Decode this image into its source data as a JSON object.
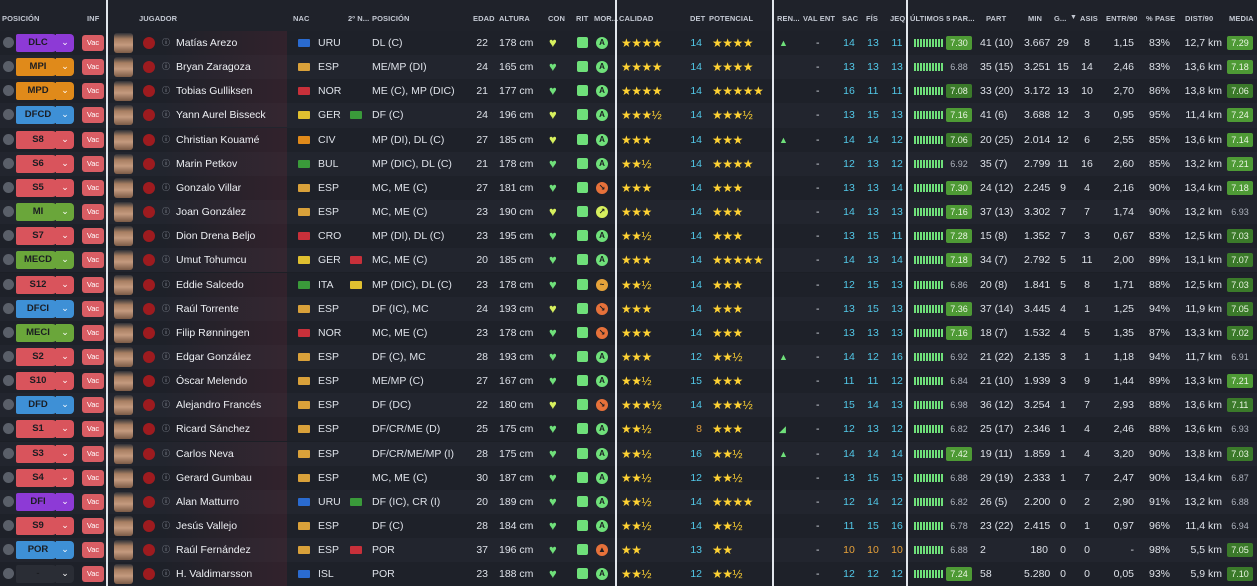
{
  "headers": {
    "posicion": "POSICIÓN",
    "inf": "INF",
    "jugador": "JUGADOR",
    "nac": "NAC",
    "nac2": "2º N...",
    "posicion2": "POSICIÓN",
    "edad": "EDAD",
    "altura": "ALTURA",
    "con": "CON",
    "rit": "RIT",
    "mor": "MOR...",
    "calidad": "CALIDAD",
    "det": "DET",
    "potencial": "POTENCIAL",
    "ren": "REN...",
    "valent": "VAL ENT",
    "sac": "SAC",
    "fis": "FÍS",
    "jeq": "JEQ",
    "ultimos": "ÚLTIMOS 5 PAR...",
    "part": "PART",
    "min": "MIN",
    "g": "G...",
    "sort_icon": "▼",
    "asis": "ASIS",
    "entr": "ENTR/90",
    "pase": "% PASE",
    "dist": "DIST/90",
    "media": "MEDIA"
  },
  "colors": {
    "purple": "#8d3ad6",
    "orange": "#e08a1a",
    "blue": "#3e90d6",
    "red": "#d9545c",
    "green": "#6aa63a",
    "navy": "#2a6bd0"
  },
  "players": [
    {
      "pos": "DLC",
      "posc": "#8d3ad6",
      "arrow": "⌄",
      "inf": "Vac",
      "name": "Matías Arezo",
      "flag": "#2a6bd0",
      "nat": "URU",
      "flag2": "",
      "posi": "DL (C)",
      "age": "22",
      "alt": "178 cm",
      "heart": "♥",
      "heartc": "#d7f05e",
      "morc": "#6fe07a",
      "mor": "A",
      "stars": "★★★★",
      "det": "14",
      "pot": "★★★★",
      "ren": "▲",
      "valent": "-",
      "sac": "14",
      "fis": "13",
      "jeq": "11",
      "sb": "7.30",
      "sbc": "hib",
      "part": "41 (10)",
      "min": "3.667",
      "g": "29",
      "asis": "8",
      "entr": "1,15",
      "pase": "83%",
      "dist": "12,7 km",
      "media": "7.29",
      "mc": "hib"
    },
    {
      "pos": "MPI",
      "posc": "#e08a1a",
      "arrow": "⌄",
      "inf": "Vac",
      "name": "Bryan Zaragoza",
      "flag": "#d9a13a",
      "nat": "ESP",
      "flag2": "",
      "posi": "ME/MP (DI)",
      "age": "24",
      "alt": "165 cm",
      "heart": "♥",
      "heartc": "#6fe07a",
      "morc": "#6fe07a",
      "mor": "A",
      "stars": "★★★★",
      "det": "14",
      "pot": "★★★★",
      "ren": "",
      "valent": "-",
      "sac": "13",
      "fis": "13",
      "jeq": "13",
      "sb": "6.88",
      "sbc": "lowb",
      "part": "35 (15)",
      "min": "3.251",
      "g": "15",
      "asis": "14",
      "entr": "2,46",
      "pase": "83%",
      "dist": "13,6 km",
      "media": "7.18",
      "mc": "hib"
    },
    {
      "pos": "MPD",
      "posc": "#e08a1a",
      "arrow": "⌄",
      "inf": "Vac",
      "name": "Tobias Gulliksen",
      "flag": "#c8303a",
      "nat": "NOR",
      "flag2": "",
      "posi": "ME (C), MP (DIC)",
      "age": "21",
      "alt": "177 cm",
      "heart": "♥",
      "heartc": "#6fe07a",
      "morc": "#6fe07a",
      "mor": "A",
      "stars": "★★★★",
      "det": "14",
      "pot": "★★★★★",
      "ren": "",
      "valent": "-",
      "sac": "16",
      "fis": "11",
      "jeq": "11",
      "sb": "7.08",
      "sbc": "midb",
      "part": "33 (20)",
      "min": "3.172",
      "g": "13",
      "asis": "10",
      "entr": "2,70",
      "pase": "86%",
      "dist": "13,8 km",
      "media": "7.06",
      "mc": "midb"
    },
    {
      "pos": "DFCD",
      "posc": "#3e90d6",
      "arrow": "⌄",
      "inf": "Vac",
      "name": "Yann Aurel Bisseck",
      "flag": "#e0c030",
      "nat": "GER",
      "flag2": "#3a9a3a",
      "posi": "DF (C)",
      "age": "24",
      "alt": "196 cm",
      "heart": "♥",
      "heartc": "#d7f05e",
      "morc": "#6fe07a",
      "mor": "A",
      "stars": "★★★½",
      "det": "14",
      "pot": "★★★½",
      "ren": "",
      "valent": "-",
      "sac": "13",
      "fis": "15",
      "jeq": "13",
      "sb": "7.16",
      "sbc": "hib",
      "part": "41 (6)",
      "min": "3.688",
      "g": "12",
      "asis": "3",
      "entr": "0,95",
      "pase": "95%",
      "dist": "11,4 km",
      "media": "7.24",
      "mc": "hib"
    },
    {
      "pos": "S8",
      "posc": "#d9545c",
      "arrow": "⌄",
      "inf": "Vac",
      "name": "Christian Kouamé",
      "flag": "#e08a1a",
      "nat": "CIV",
      "flag2": "",
      "posi": "MP (DI), DL (C)",
      "age": "27",
      "alt": "185 cm",
      "heart": "♥",
      "heartc": "#d7f05e",
      "morc": "#6fe07a",
      "mor": "A",
      "stars": "★★★",
      "det": "14",
      "pot": "★★★",
      "ren": "▲",
      "valent": "-",
      "sac": "14",
      "fis": "14",
      "jeq": "12",
      "sb": "7.06",
      "sbc": "midb",
      "part": "20 (25)",
      "min": "2.014",
      "g": "12",
      "asis": "6",
      "entr": "2,55",
      "pase": "85%",
      "dist": "13,6 km",
      "media": "7.14",
      "mc": "hib"
    },
    {
      "pos": "S6",
      "posc": "#d9545c",
      "arrow": "⌄",
      "inf": "Vac",
      "name": "Marin Petkov",
      "flag": "#3a9a3a",
      "nat": "BUL",
      "flag2": "",
      "posi": "MP (DIC), DL (C)",
      "age": "21",
      "alt": "178 cm",
      "heart": "♥",
      "heartc": "#6fe07a",
      "morc": "#6fe07a",
      "mor": "A",
      "stars": "★★½",
      "det": "14",
      "pot": "★★★★",
      "ren": "",
      "valent": "-",
      "sac": "12",
      "fis": "13",
      "jeq": "12",
      "sb": "6.92",
      "sbc": "lowb",
      "part": "35 (7)",
      "min": "2.799",
      "g": "11",
      "asis": "16",
      "entr": "2,60",
      "pase": "85%",
      "dist": "13,2 km",
      "media": "7.21",
      "mc": "hib"
    },
    {
      "pos": "S5",
      "posc": "#d9545c",
      "arrow": "⌄",
      "inf": "Vac",
      "name": "Gonzalo Villar",
      "flag": "#d9a13a",
      "nat": "ESP",
      "flag2": "",
      "posi": "MC, ME (C)",
      "age": "27",
      "alt": "181 cm",
      "heart": "♥",
      "heartc": "#6fe07a",
      "morc": "#e6713a",
      "mor": "↘",
      "stars": "★★★",
      "det": "14",
      "pot": "★★★",
      "ren": "",
      "valent": "-",
      "sac": "13",
      "fis": "13",
      "jeq": "14",
      "sb": "7.30",
      "sbc": "hib",
      "part": "24 (12)",
      "min": "2.245",
      "g": "9",
      "asis": "4",
      "entr": "2,16",
      "pase": "90%",
      "dist": "13,4 km",
      "media": "7.18",
      "mc": "hib"
    },
    {
      "pos": "MI",
      "posc": "#6aa63a",
      "arrow": "⌄",
      "inf": "Vac",
      "name": "Joan González",
      "flag": "#d9a13a",
      "nat": "ESP",
      "flag2": "",
      "posi": "MC, ME (C)",
      "age": "23",
      "alt": "190 cm",
      "heart": "♥",
      "heartc": "#d7f05e",
      "morc": "#d7f05e",
      "mor": "↗",
      "stars": "★★★",
      "det": "14",
      "pot": "★★★",
      "ren": "",
      "valent": "-",
      "sac": "14",
      "fis": "13",
      "jeq": "13",
      "sb": "7.16",
      "sbc": "hib",
      "part": "37 (13)",
      "min": "3.302",
      "g": "7",
      "asis": "7",
      "entr": "1,74",
      "pase": "90%",
      "dist": "13,2 km",
      "media": "6.93",
      "mc": "lowb"
    },
    {
      "pos": "S7",
      "posc": "#d9545c",
      "arrow": "⌄",
      "inf": "Vac",
      "name": "Dion Drena Beljo",
      "flag": "#c8303a",
      "nat": "CRO",
      "flag2": "",
      "posi": "MP (DI), DL (C)",
      "age": "23",
      "alt": "195 cm",
      "heart": "♥",
      "heartc": "#6fe07a",
      "morc": "#6fe07a",
      "mor": "A",
      "stars": "★★½",
      "det": "14",
      "pot": "★★★",
      "ren": "",
      "valent": "-",
      "sac": "13",
      "fis": "15",
      "jeq": "11",
      "sb": "7.28",
      "sbc": "hib",
      "part": "15 (8)",
      "min": "1.352",
      "g": "7",
      "asis": "3",
      "entr": "0,67",
      "pase": "83%",
      "dist": "12,5 km",
      "media": "7.03",
      "mc": "midb"
    },
    {
      "pos": "MECD",
      "posc": "#6aa63a",
      "arrow": "⌄",
      "inf": "Vac",
      "name": "Umut Tohumcu",
      "flag": "#e0c030",
      "nat": "GER",
      "flag2": "#c8303a",
      "posi": "MC, ME (C)",
      "age": "20",
      "alt": "185 cm",
      "heart": "♥",
      "heartc": "#6fe07a",
      "morc": "#6fe07a",
      "mor": "A",
      "stars": "★★★",
      "det": "14",
      "pot": "★★★★★",
      "ren": "",
      "valent": "-",
      "sac": "14",
      "fis": "13",
      "jeq": "14",
      "sb": "7.18",
      "sbc": "hib",
      "part": "34 (7)",
      "min": "2.792",
      "g": "5",
      "asis": "11",
      "entr": "2,00",
      "pase": "89%",
      "dist": "13,1 km",
      "media": "7.07",
      "mc": "midb"
    },
    {
      "pos": "S12",
      "posc": "#d9545c",
      "arrow": "⌄",
      "inf": "Vac",
      "name": "Eddie Salcedo",
      "flag": "#3a9a3a",
      "nat": "ITA",
      "flag2": "#e0c030",
      "posi": "MP (DIC), DL (C)",
      "age": "23",
      "alt": "178 cm",
      "heart": "♥",
      "heartc": "#6fe07a",
      "morc": "#e6a33a",
      "mor": "~",
      "stars": "★★½",
      "det": "14",
      "pot": "★★★",
      "ren": "",
      "valent": "-",
      "sac": "12",
      "fis": "15",
      "jeq": "13",
      "sb": "6.86",
      "sbc": "lowb",
      "part": "20 (8)",
      "min": "1.841",
      "g": "5",
      "asis": "8",
      "entr": "1,71",
      "pase": "88%",
      "dist": "12,5 km",
      "media": "7.03",
      "mc": "midb"
    },
    {
      "pos": "DFCI",
      "posc": "#3e90d6",
      "arrow": "⌄",
      "inf": "Vac",
      "name": "Raúl Torrente",
      "flag": "#d9a13a",
      "nat": "ESP",
      "flag2": "",
      "posi": "DF (IC), MC",
      "age": "24",
      "alt": "193 cm",
      "heart": "♥",
      "heartc": "#d7f05e",
      "morc": "#e6713a",
      "mor": "↘",
      "stars": "★★★",
      "det": "14",
      "pot": "★★★",
      "ren": "",
      "valent": "-",
      "sac": "13",
      "fis": "15",
      "jeq": "13",
      "sb": "7.36",
      "sbc": "hib",
      "part": "37 (14)",
      "min": "3.445",
      "g": "4",
      "asis": "1",
      "entr": "1,25",
      "pase": "94%",
      "dist": "11,9 km",
      "media": "7.05",
      "mc": "midb"
    },
    {
      "pos": "MECI",
      "posc": "#6aa63a",
      "arrow": "⌄",
      "inf": "Vac",
      "name": "Filip Rønningen",
      "flag": "#c8303a",
      "nat": "NOR",
      "flag2": "",
      "posi": "MC, ME (C)",
      "age": "23",
      "alt": "178 cm",
      "heart": "♥",
      "heartc": "#6fe07a",
      "morc": "#e6713a",
      "mor": "↘",
      "stars": "★★★",
      "det": "14",
      "pot": "★★★",
      "ren": "",
      "valent": "-",
      "sac": "13",
      "fis": "13",
      "jeq": "13",
      "sb": "7.16",
      "sbc": "hib",
      "part": "18 (7)",
      "min": "1.532",
      "g": "4",
      "asis": "5",
      "entr": "1,35",
      "pase": "87%",
      "dist": "13,3 km",
      "media": "7.02",
      "mc": "midb"
    },
    {
      "pos": "S2",
      "posc": "#d9545c",
      "arrow": "⌄",
      "inf": "Vac",
      "name": "Edgar González",
      "flag": "#d9a13a",
      "nat": "ESP",
      "flag2": "",
      "posi": "DF (C), MC",
      "age": "28",
      "alt": "193 cm",
      "heart": "♥",
      "heartc": "#6fe07a",
      "morc": "#6fe07a",
      "mor": "A",
      "stars": "★★★",
      "det": "12",
      "pot": "★★½",
      "ren": "▲",
      "valent": "-",
      "sac": "14",
      "fis": "12",
      "jeq": "16",
      "sb": "6.92",
      "sbc": "lowb",
      "part": "21 (22)",
      "min": "2.135",
      "g": "3",
      "asis": "1",
      "entr": "1,18",
      "pase": "94%",
      "dist": "11,7 km",
      "media": "6.91",
      "mc": "lowb"
    },
    {
      "pos": "S10",
      "posc": "#d9545c",
      "arrow": "⌄",
      "inf": "Vac",
      "name": "Óscar Melendo",
      "flag": "#d9a13a",
      "nat": "ESP",
      "flag2": "",
      "posi": "ME/MP (C)",
      "age": "27",
      "alt": "167 cm",
      "heart": "♥",
      "heartc": "#6fe07a",
      "morc": "#6fe07a",
      "mor": "A",
      "stars": "★★½",
      "det": "15",
      "pot": "★★★",
      "ren": "",
      "valent": "-",
      "sac": "11",
      "fis": "11",
      "jeq": "12",
      "sb": "6.84",
      "sbc": "lowb",
      "part": "21 (10)",
      "min": "1.939",
      "g": "3",
      "asis": "9",
      "entr": "1,44",
      "pase": "89%",
      "dist": "13,3 km",
      "media": "7.21",
      "mc": "hib"
    },
    {
      "pos": "DFD",
      "posc": "#3e90d6",
      "arrow": "⌄",
      "inf": "Vac",
      "name": "Alejandro Francés",
      "flag": "#d9a13a",
      "nat": "ESP",
      "flag2": "",
      "posi": "DF (DC)",
      "age": "22",
      "alt": "180 cm",
      "heart": "♥",
      "heartc": "#d7f05e",
      "morc": "#e6713a",
      "mor": "↘",
      "stars": "★★★½",
      "det": "14",
      "pot": "★★★½",
      "ren": "",
      "valent": "-",
      "sac": "15",
      "fis": "14",
      "jeq": "13",
      "sb": "6.98",
      "sbc": "lowb",
      "part": "36 (12)",
      "min": "3.254",
      "g": "1",
      "asis": "7",
      "entr": "2,93",
      "pase": "88%",
      "dist": "13,6 km",
      "media": "7.11",
      "mc": "midb"
    },
    {
      "pos": "S1",
      "posc": "#d9545c",
      "arrow": "⌄",
      "inf": "Vac",
      "name": "Ricard Sánchez",
      "flag": "#d9a13a",
      "nat": "ESP",
      "flag2": "",
      "posi": "DF/CR/ME (D)",
      "age": "25",
      "alt": "175 cm",
      "heart": "♥",
      "heartc": "#6fe07a",
      "morc": "#6fe07a",
      "mor": "A",
      "stars": "★★½",
      "det": "8",
      "pot": "★★★",
      "ren": "◢",
      "valent": "-",
      "sac": "12",
      "fis": "13",
      "jeq": "12",
      "sb": "6.82",
      "sbc": "lowb",
      "part": "25 (17)",
      "min": "2.346",
      "g": "1",
      "asis": "4",
      "entr": "2,46",
      "pase": "88%",
      "dist": "13,6 km",
      "media": "6.93",
      "mc": "lowb"
    },
    {
      "pos": "S3",
      "posc": "#d9545c",
      "arrow": "⌄",
      "inf": "Vac",
      "name": "Carlos Neva",
      "flag": "#d9a13a",
      "nat": "ESP",
      "flag2": "",
      "posi": "DF/CR/ME/MP (I)",
      "age": "28",
      "alt": "175 cm",
      "heart": "♥",
      "heartc": "#6fe07a",
      "morc": "#6fe07a",
      "mor": "A",
      "stars": "★★½",
      "det": "16",
      "pot": "★★½",
      "ren": "▲",
      "valent": "-",
      "sac": "14",
      "fis": "14",
      "jeq": "14",
      "sb": "7.42",
      "sbc": "hib",
      "part": "19 (11)",
      "min": "1.859",
      "g": "1",
      "asis": "4",
      "entr": "3,20",
      "pase": "90%",
      "dist": "13,8 km",
      "media": "7.03",
      "mc": "midb"
    },
    {
      "pos": "S4",
      "posc": "#d9545c",
      "arrow": "⌄",
      "inf": "Vac",
      "name": "Gerard Gumbau",
      "flag": "#d9a13a",
      "nat": "ESP",
      "flag2": "",
      "posi": "MC, ME (C)",
      "age": "30",
      "alt": "187 cm",
      "heart": "♥",
      "heartc": "#6fe07a",
      "morc": "#6fe07a",
      "mor": "A",
      "stars": "★★½",
      "det": "12",
      "pot": "★★½",
      "ren": "",
      "valent": "-",
      "sac": "13",
      "fis": "15",
      "jeq": "15",
      "sb": "6.88",
      "sbc": "lowb",
      "part": "29 (19)",
      "min": "2.333",
      "g": "1",
      "asis": "7",
      "entr": "2,47",
      "pase": "90%",
      "dist": "13,4 km",
      "media": "6.87",
      "mc": "lowb"
    },
    {
      "pos": "DFI",
      "posc": "#8d3ad6",
      "arrow": "⌄",
      "inf": "Vac",
      "name": "Alan Matturro",
      "flag": "#2a6bd0",
      "nat": "URU",
      "flag2": "#3a9a3a",
      "posi": "DF (IC), CR (I)",
      "age": "20",
      "alt": "189 cm",
      "heart": "♥",
      "heartc": "#6fe07a",
      "morc": "#6fe07a",
      "mor": "A",
      "stars": "★★½",
      "det": "14",
      "pot": "★★★★",
      "ren": "",
      "valent": "-",
      "sac": "12",
      "fis": "14",
      "jeq": "12",
      "sb": "6.82",
      "sbc": "lowb",
      "part": "26 (5)",
      "min": "2.200",
      "g": "0",
      "asis": "2",
      "entr": "2,90",
      "pase": "91%",
      "dist": "13,2 km",
      "media": "6.88",
      "mc": "lowb"
    },
    {
      "pos": "S9",
      "posc": "#d9545c",
      "arrow": "⌄",
      "inf": "Vac",
      "name": "Jesús Vallejo",
      "flag": "#d9a13a",
      "nat": "ESP",
      "flag2": "",
      "posi": "DF (C)",
      "age": "28",
      "alt": "184 cm",
      "heart": "♥",
      "heartc": "#6fe07a",
      "morc": "#6fe07a",
      "mor": "A",
      "stars": "★★½",
      "det": "14",
      "pot": "★★½",
      "ren": "",
      "valent": "-",
      "sac": "11",
      "fis": "15",
      "jeq": "16",
      "sb": "6.78",
      "sbc": "lowb",
      "part": "23 (22)",
      "min": "2.415",
      "g": "0",
      "asis": "1",
      "entr": "0,97",
      "pase": "96%",
      "dist": "11,4 km",
      "media": "6.94",
      "mc": "lowb"
    },
    {
      "pos": "POR",
      "posc": "#3e90d6",
      "arrow": "⌄",
      "inf": "Vac",
      "name": "Raúl Fernández",
      "flag": "#d9a13a",
      "nat": "ESP",
      "flag2": "#c8303a",
      "posi": "POR",
      "age": "37",
      "alt": "196 cm",
      "heart": "♥",
      "heartc": "#6fe07a",
      "morc": "#e6713a",
      "mor": "▲",
      "stars": "★★",
      "det": "13",
      "pot": "★★",
      "ren": "",
      "valent": "-",
      "sac": "10",
      "fis": "10",
      "jeq": "10",
      "sb": "6.88",
      "sbc": "lowb",
      "part": "2",
      "min": "180",
      "g": "0",
      "asis": "0",
      "entr": "-",
      "pase": "98%",
      "dist": "5,5 km",
      "media": "7.05",
      "mc": "midb"
    },
    {
      "pos": "-",
      "posc": "#2a2d35",
      "arrow": "⌄",
      "inf": "Vac",
      "name": "H. Valdimarsson",
      "flag": "#2a6bd0",
      "nat": "ISL",
      "flag2": "",
      "posi": "POR",
      "age": "23",
      "alt": "188 cm",
      "heart": "♥",
      "heartc": "#6fe07a",
      "morc": "#6fe07a",
      "mor": "A",
      "stars": "★★½",
      "det": "12",
      "pot": "★★½",
      "ren": "",
      "valent": "-",
      "sac": "12",
      "fis": "12",
      "jeq": "12",
      "sb": "7.24",
      "sbc": "hib",
      "part": "58",
      "min": "5.280",
      "g": "0",
      "asis": "0",
      "entr": "0,05",
      "pase": "93%",
      "dist": "5,9 km",
      "media": "7.10",
      "mc": "midb"
    }
  ]
}
